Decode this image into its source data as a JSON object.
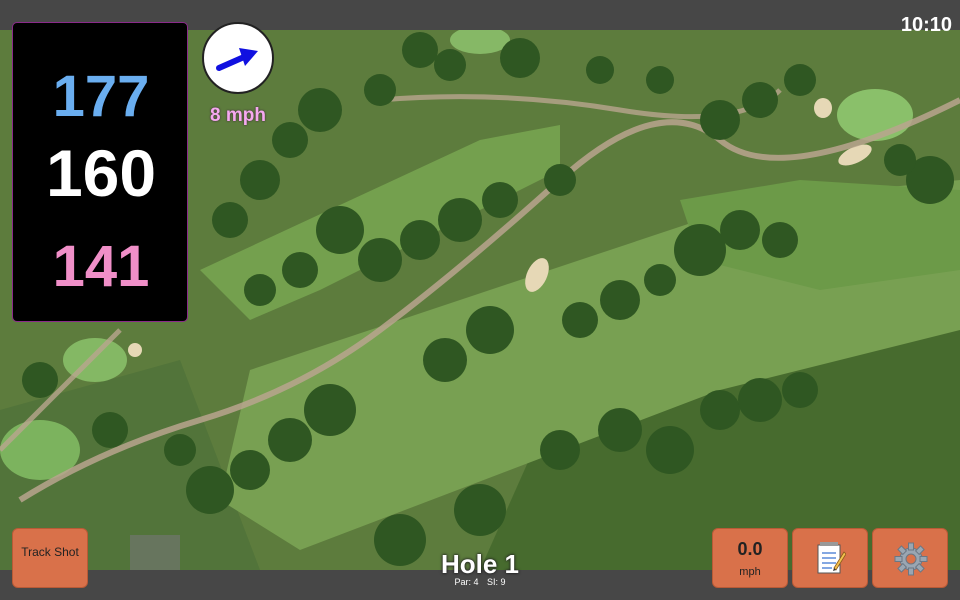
{
  "status_bar": {
    "time": "10:10"
  },
  "distances": {
    "back": "177",
    "middle": "160",
    "front": "141"
  },
  "wind": {
    "speed_label": "8 mph",
    "direction_icon": "arrow-icon"
  },
  "buttons": {
    "track_shot_label": "Track Shot",
    "speed_value": "0.0",
    "speed_unit": "mph",
    "notes_icon": "notepad-icon",
    "settings_icon": "gear-icon"
  },
  "hole": {
    "title": "Hole 1",
    "par": "Par: 4",
    "stroke_index": "SI: 9"
  },
  "colors": {
    "back_distance": "#6aaef0",
    "middle_distance": "#ffffff",
    "front_distance": "#f08fc8",
    "button": "#d9714a",
    "wind_label": "#f5a9ef"
  }
}
